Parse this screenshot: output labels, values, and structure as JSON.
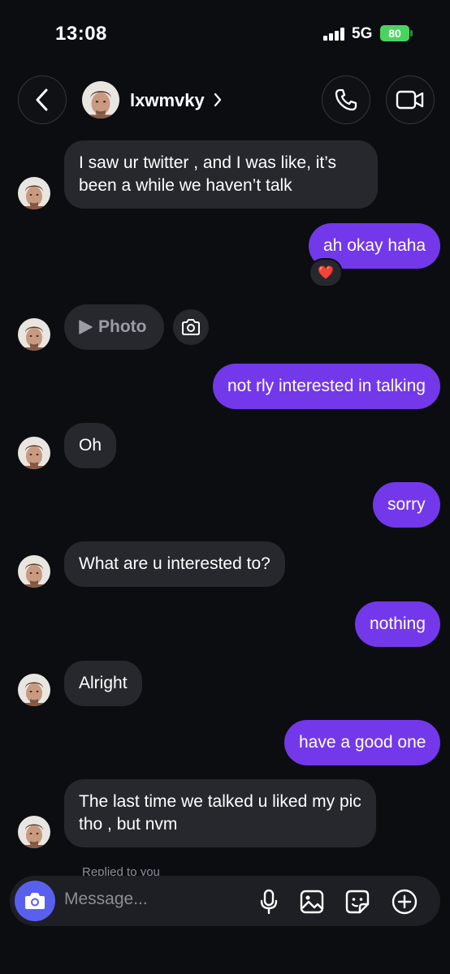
{
  "status": {
    "time": "13:08",
    "network": "5G",
    "battery": "80"
  },
  "header": {
    "username": "lxwmvky"
  },
  "messages": {
    "m1": "I saw ur twitter , and I was like, it’s been a while we haven’t talk",
    "m2": "ah okay haha",
    "m2_reaction": "❤️",
    "m3_label": "Photo",
    "m4": "not rly interested in talking",
    "m5": "Oh",
    "m6": "sorry",
    "m7": "What are u interested to?",
    "m8": "nothing",
    "m9": "Alright",
    "m10": "have a good one",
    "m11": "The last time we talked u liked my pic tho , but nvm",
    "replied_note": "Replied to you"
  },
  "composer": {
    "placeholder": "Message..."
  },
  "icons": {
    "back": "chevron-left-icon",
    "call": "phone-icon",
    "video": "video-camera-icon",
    "photo_play": "play-icon",
    "camera": "camera-icon",
    "mic": "microphone-icon",
    "gallery": "image-icon",
    "sticker": "sticker-icon",
    "add": "plus-circle-icon"
  },
  "colors": {
    "background": "#0c0d11",
    "incoming_bubble": "#26282e",
    "outgoing_bubble": "#7338ea",
    "composer_camera": "#5a60ee",
    "battery": "#4ad361"
  }
}
